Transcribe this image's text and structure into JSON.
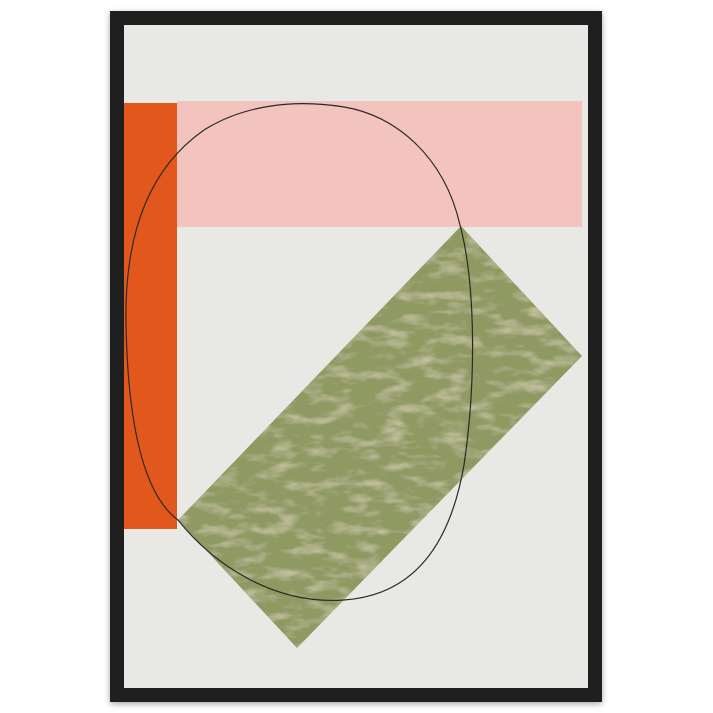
{
  "artwork": {
    "colors": {
      "frame": "#1f1f1f",
      "paper": "#e8e9e5",
      "orange": "#e2571b",
      "pink": "#f3c4bd",
      "olive": "#8f9a63",
      "olive_light": "#b9b07f",
      "line": "#2a2a24"
    }
  }
}
